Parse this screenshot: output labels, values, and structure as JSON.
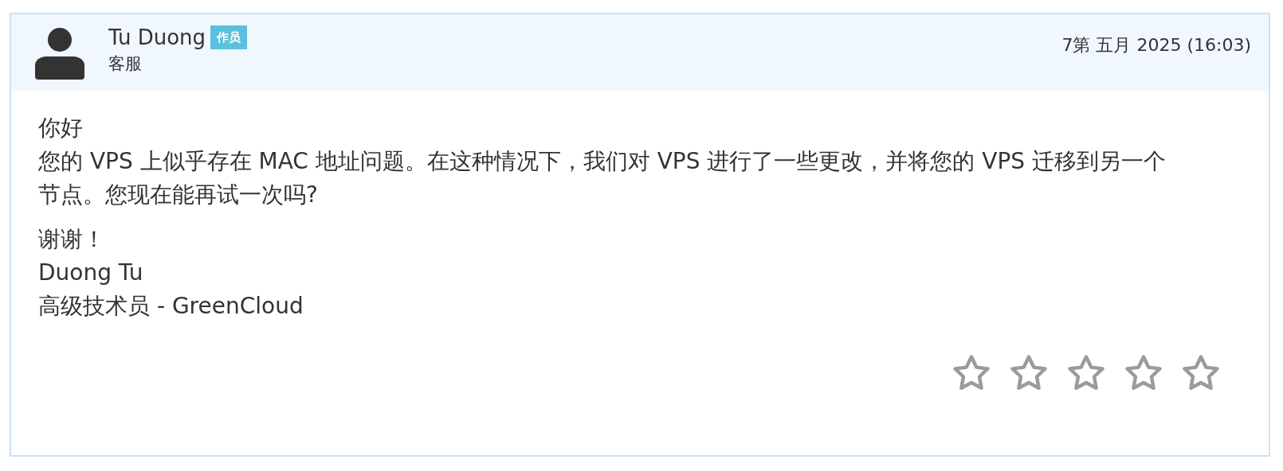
{
  "message": {
    "author": {
      "name": "Tu Duong",
      "badge": "作员",
      "role": "客服"
    },
    "date": "7第 五月 2025 (16:03)",
    "greeting": "你好",
    "body": "您的 VPS 上似乎存在 MAC 地址问题。在这种情况下，我们对 VPS 进行了一些更改，并将您的 VPS 迁移到另一个节点。您现在能再试一次吗?",
    "signature": [
      "谢谢！",
      "Duong Tu",
      "高级技术员 - GreenCloud"
    ],
    "rating": {
      "stars": 0
    }
  }
}
